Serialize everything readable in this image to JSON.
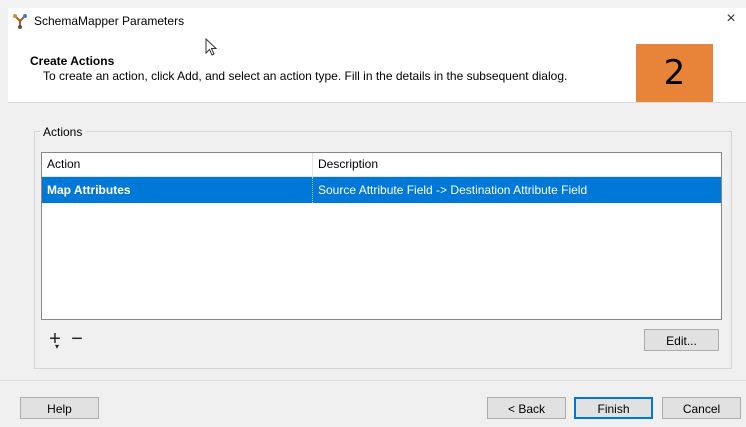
{
  "window": {
    "title": "SchemaMapper Parameters",
    "close_glyph": "×",
    "app_icon": "schemamapper-icon"
  },
  "header": {
    "title": "Create Actions",
    "description": "To create an action, click Add, and select an action type. Fill in the details in the subsequent dialog.",
    "step_badge": "2"
  },
  "actions_group": {
    "label": "Actions",
    "columns": [
      "Action",
      "Description"
    ],
    "rows": [
      {
        "action": "Map Attributes",
        "description": "Source Attribute Field -> Destination Attribute Field",
        "selected": true
      }
    ],
    "add_glyph": "+",
    "remove_glyph": "−",
    "edit_label": "Edit..."
  },
  "footer": {
    "help_label": "Help",
    "back_label": "< Back",
    "finish_label": "Finish",
    "cancel_label": "Cancel"
  },
  "colors": {
    "selection": "#0078d7",
    "badge": "#e8833a"
  }
}
